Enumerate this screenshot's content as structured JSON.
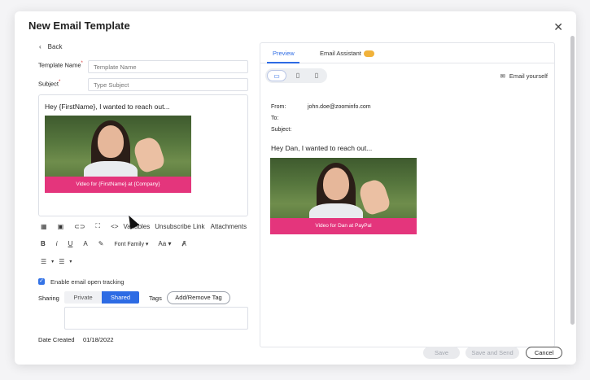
{
  "modal": {
    "title": "New Email Template",
    "close": "✕"
  },
  "form": {
    "back_label": "Back",
    "template_name_label": "Template Name",
    "template_name_placeholder": "Template Name",
    "subject_label": "Subject",
    "subject_placeholder": "Type Subject",
    "required_mark": "*",
    "body_greeting": "Hey {FirstName}, I wanted to reach out...",
    "video_caption": "Video for {FirstName} at {Company}",
    "toolbar_variables": "Variables",
    "toolbar_unsubscribe": "Unsubscribe Link",
    "toolbar_attachments": "Attachments",
    "toolbar_font_family": "Font Family",
    "toolbar_font_size": "Aa",
    "tracking_label": "Enable email open tracking",
    "tracking_checked": true,
    "sharing_label": "Sharing",
    "sharing_private": "Private",
    "sharing_shared": "Shared",
    "tags_label": "Tags",
    "tags_button": "Add/Remove Tag",
    "date_created_label": "Date Created",
    "date_created_value": "01/18/2022"
  },
  "preview": {
    "tab_preview": "Preview",
    "tab_assistant": "Email Assistant",
    "email_yourself": "Email yourself",
    "from_label": "From:",
    "from_value": "john.doe@zoominfo.com",
    "to_label": "To:",
    "subject_label": "Subject:",
    "greeting": "Hey Dan, I wanted to reach out...",
    "video_caption": "Video for Dan at PayPal"
  },
  "footer": {
    "save": "Save",
    "save_and_send": "Save and Send",
    "cancel": "Cancel"
  },
  "colors": {
    "accent": "#2d6be4",
    "video_bar": "#e4357c",
    "badge": "#f1b23a"
  }
}
